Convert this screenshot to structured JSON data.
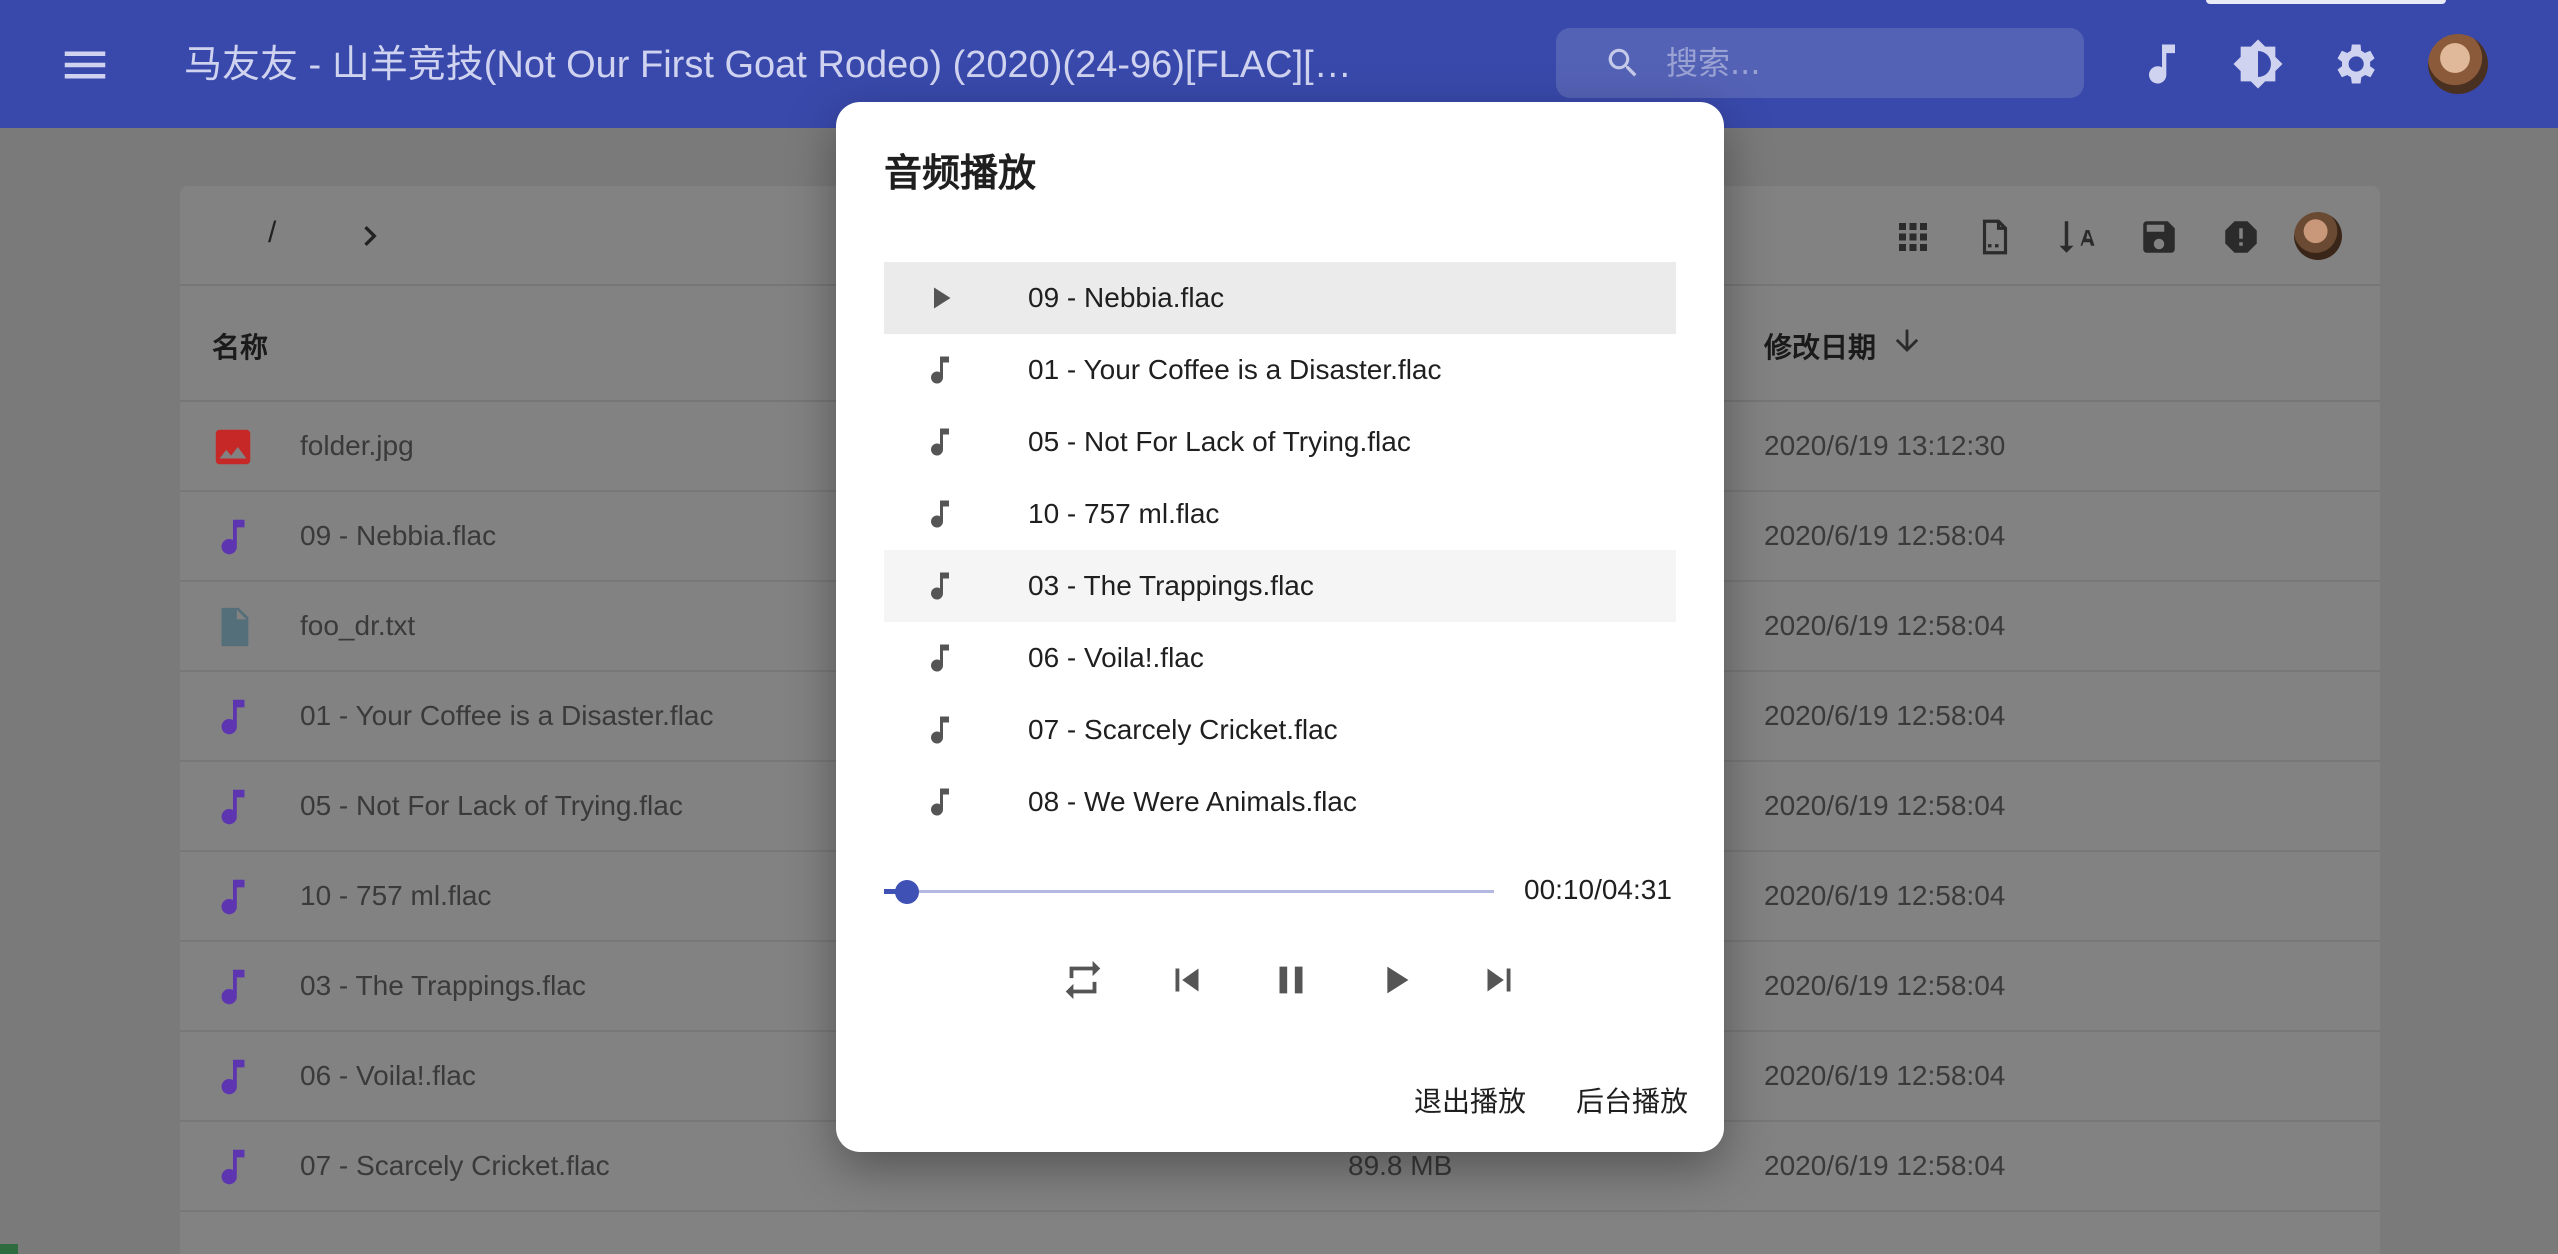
{
  "appbar": {
    "title": "马友友 - 山羊竞技(Not Our First Goat Rodeo) (2020)(24-96)[FLAC][…",
    "search_placeholder": "搜索..."
  },
  "breadcrumb": {
    "separator": "/"
  },
  "columns": {
    "name": "名称",
    "modified": "修改日期"
  },
  "files": [
    {
      "name": "folder.jpg",
      "size": "",
      "date": "2020/6/19 13:12:30",
      "icon": "image-icon",
      "color": "#c62828"
    },
    {
      "name": "09 - Nebbia.flac",
      "size": "",
      "date": "2020/6/19 12:58:04",
      "icon": "music-note-icon",
      "color": "#5e35b1"
    },
    {
      "name": "foo_dr.txt",
      "size": "",
      "date": "2020/6/19 12:58:04",
      "icon": "text-file-icon",
      "color": "#546e7a"
    },
    {
      "name": "01 - Your Coffee is a Disaster.flac",
      "size": "",
      "date": "2020/6/19 12:58:04",
      "icon": "music-note-icon",
      "color": "#5e35b1"
    },
    {
      "name": "05 - Not For Lack of Trying.flac",
      "size": "",
      "date": "2020/6/19 12:58:04",
      "icon": "music-note-icon",
      "color": "#5e35b1"
    },
    {
      "name": "10 - 757 ml.flac",
      "size": "",
      "date": "2020/6/19 12:58:04",
      "icon": "music-note-icon",
      "color": "#5e35b1"
    },
    {
      "name": "03 - The Trappings.flac",
      "size": "",
      "date": "2020/6/19 12:58:04",
      "icon": "music-note-icon",
      "color": "#5e35b1"
    },
    {
      "name": "06 - Voila!.flac",
      "size": "",
      "date": "2020/6/19 12:58:04",
      "icon": "music-note-icon",
      "color": "#5e35b1"
    },
    {
      "name": "07 - Scarcely Cricket.flac",
      "size": "89.8 MB",
      "date": "2020/6/19 12:58:04",
      "icon": "music-note-icon",
      "color": "#5e35b1"
    }
  ],
  "dialog": {
    "title": "音频播放",
    "playlist": [
      {
        "name": "09 - Nebbia.flac",
        "state": "playing"
      },
      {
        "name": "01 - Your Coffee is a Disaster.flac",
        "state": ""
      },
      {
        "name": "05 - Not For Lack of Trying.flac",
        "state": ""
      },
      {
        "name": "10 - 757 ml.flac",
        "state": ""
      },
      {
        "name": "03 - The Trappings.flac",
        "state": "hover"
      },
      {
        "name": "06 - Voila!.flac",
        "state": ""
      },
      {
        "name": "07 - Scarcely Cricket.flac",
        "state": ""
      },
      {
        "name": "08 - We Were Animals.flac",
        "state": ""
      }
    ],
    "progress_fraction": 0.037,
    "time": "00:10/04:31",
    "exit_label": "退出播放",
    "background_label": "后台播放"
  },
  "colors": {
    "primary": "#3f51b5",
    "appbar": "#3949ab"
  }
}
